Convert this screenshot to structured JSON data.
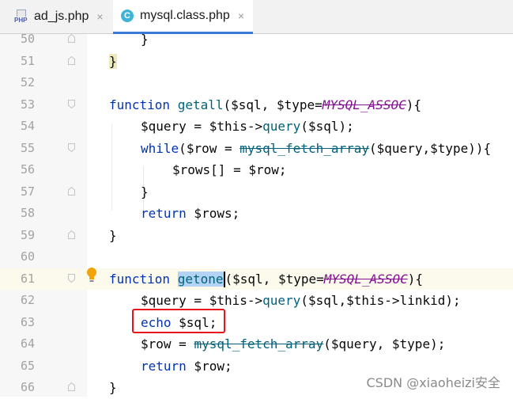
{
  "tabs": [
    {
      "label": "ad_js.php",
      "icon": "php-file-icon",
      "close": "×",
      "active": false
    },
    {
      "label": "mysql.class.php",
      "icon": "class-file-icon",
      "close": "×",
      "active": true
    }
  ],
  "editor": {
    "current_line": "61",
    "lines": [
      {
        "num": "50"
      },
      {
        "num": "51"
      },
      {
        "num": "52"
      },
      {
        "num": "53"
      },
      {
        "num": "54"
      },
      {
        "num": "55"
      },
      {
        "num": "56"
      },
      {
        "num": "57"
      },
      {
        "num": "58"
      },
      {
        "num": "59"
      },
      {
        "num": "60"
      },
      {
        "num": "61"
      },
      {
        "num": "62"
      },
      {
        "num": "63"
      },
      {
        "num": "64"
      },
      {
        "num": "65"
      },
      {
        "num": "66"
      }
    ],
    "tokens": {
      "l50_brace": "}",
      "l51_brace": "}",
      "l53_function": "function",
      "l53_name": "getall",
      "l53_open": "(",
      "l53_sql": "$sql",
      "l53_sep": ", ",
      "l53_type": "$type",
      "l53_eq": "=",
      "l53_const": "MYSQL_ASSOC",
      "l53_close": "){",
      "l54_query": "$query",
      "l54_eq": " = ",
      "l54_this": "$this",
      "l54_arrow": "->",
      "l54_method": "query",
      "l54_open": "(",
      "l54_sql": "$sql",
      "l54_close": ");",
      "l55_while": "while",
      "l55_open": "(",
      "l55_row": "$row",
      "l55_eq": " = ",
      "l55_fn": "mysql_fetch_array",
      "l55_open2": "(",
      "l55_query": "$query",
      "l55_comma": ",",
      "l55_type": "$type",
      "l55_close": ")){",
      "l56_rows": "$rows",
      "l56_mid": "[] = ",
      "l56_row": "$row",
      "l56_end": ";",
      "l57_brace": "}",
      "l58_return": "return",
      "l58_rows": " $rows",
      "l58_end": ";",
      "l59_brace": "}",
      "l61_function": "function",
      "l61_name": "getone",
      "l61_open": "(",
      "l61_sql": "$sql",
      "l61_sep": ", ",
      "l61_type": "$type",
      "l61_eq": "=",
      "l61_const": "MYSQL_ASSOC",
      "l61_close": "){",
      "l62_query": "$query",
      "l62_eq": " = ",
      "l62_this": "$this",
      "l62_arrow": "->",
      "l62_method": "query",
      "l62_open": "(",
      "l62_sql": "$sql",
      "l62_comma": ",",
      "l62_this2": "$this",
      "l62_arrow2": "->",
      "l62_linkid": "linkid",
      "l62_close": ");",
      "l63_echo": "echo",
      "l63_sql": " $sql",
      "l63_end": ";",
      "l64_row": "$row",
      "l64_eq": " = ",
      "l64_fn": "mysql_fetch_array",
      "l64_open": "(",
      "l64_query": "$query",
      "l64_sep": ", ",
      "l64_type": "$type",
      "l64_close": ");",
      "l65_return": "return",
      "l65_row": " $row",
      "l65_end": ";",
      "l66_brace": "}"
    }
  },
  "watermark": "CSDN @xiaoheizi安全",
  "colors": {
    "keyword": "#0033b3",
    "function": "#00627a",
    "variable": "#660e7a",
    "constant": "#871094",
    "highlight_box": "#e8141b",
    "active_tab_underline": "#3a7ad8"
  }
}
